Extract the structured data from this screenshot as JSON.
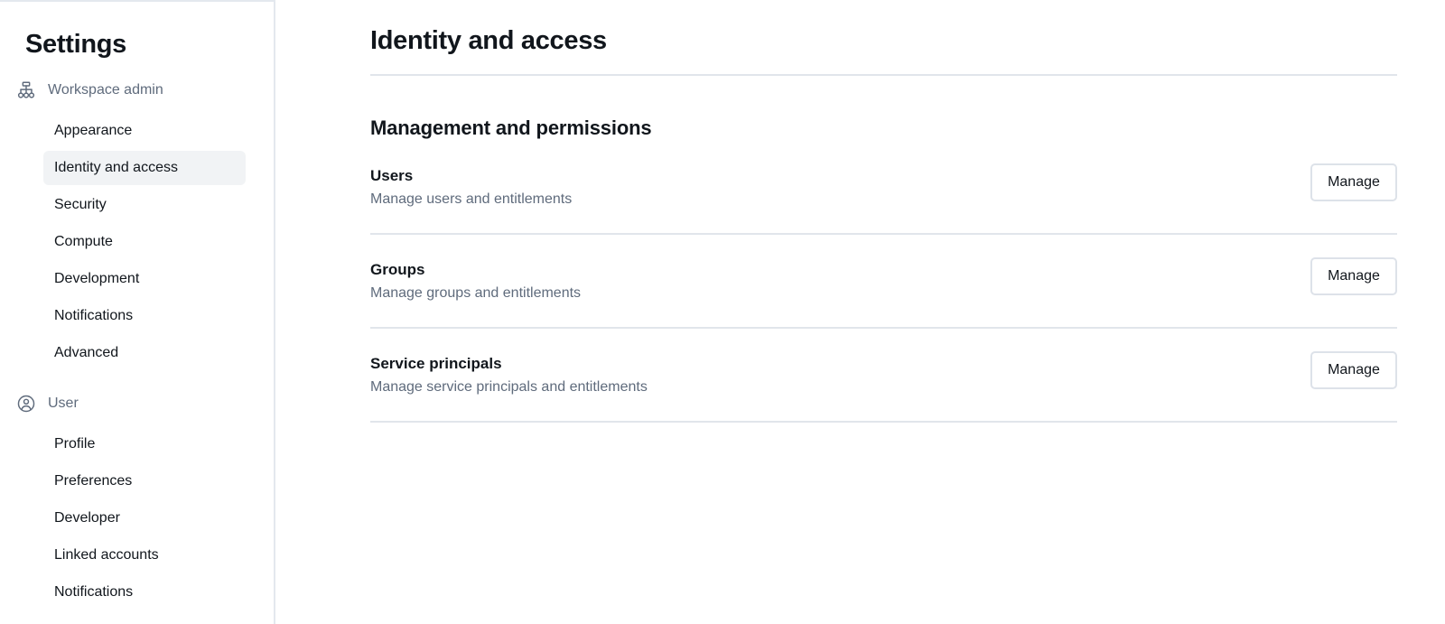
{
  "sidebar": {
    "title": "Settings",
    "groups": [
      {
        "label": "Workspace admin",
        "icon": "org-hierarchy-icon",
        "items": [
          {
            "label": "Appearance",
            "selected": false
          },
          {
            "label": "Identity and access",
            "selected": true
          },
          {
            "label": "Security",
            "selected": false
          },
          {
            "label": "Compute",
            "selected": false
          },
          {
            "label": "Development",
            "selected": false
          },
          {
            "label": "Notifications",
            "selected": false
          },
          {
            "label": "Advanced",
            "selected": false
          }
        ]
      },
      {
        "label": "User",
        "icon": "user-circle-icon",
        "items": [
          {
            "label": "Profile",
            "selected": false
          },
          {
            "label": "Preferences",
            "selected": false
          },
          {
            "label": "Developer",
            "selected": false
          },
          {
            "label": "Linked accounts",
            "selected": false
          },
          {
            "label": "Notifications",
            "selected": false
          }
        ]
      }
    ]
  },
  "main": {
    "page_title": "Identity and access",
    "section_title": "Management and permissions",
    "rows": [
      {
        "title": "Users",
        "description": "Manage users and entitlements",
        "action": "Manage"
      },
      {
        "title": "Groups",
        "description": "Manage groups and entitlements",
        "action": "Manage"
      },
      {
        "title": "Service principals",
        "description": "Manage service principals and entitlements",
        "action": "Manage"
      }
    ]
  },
  "colors": {
    "text_primary": "#11161c",
    "text_muted": "#5f6b7c",
    "border": "#e1e5eb",
    "selected_bg": "#f1f3f5",
    "surface": "#ffffff"
  }
}
